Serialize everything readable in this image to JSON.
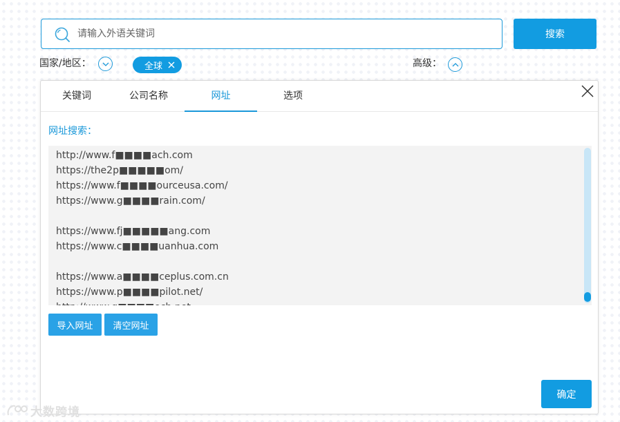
{
  "search": {
    "placeholder": "请输入外语关键词",
    "button_label": "搜索"
  },
  "filters": {
    "region_label": "国家/地区：",
    "region_tag": "全球",
    "advanced_label": "高级："
  },
  "modal": {
    "tabs": [
      {
        "label": "关键词",
        "active": false
      },
      {
        "label": "公司名称",
        "active": false
      },
      {
        "label": "网址",
        "active": true
      },
      {
        "label": "选项",
        "active": false
      }
    ],
    "section_label": "网址搜索：",
    "urls": [
      "http://www.f■■■■ach.com",
      "https://the2p■■■■■om/",
      "https://www.f■■■■ourceusa.com/",
      "https://www.g■■■■rain.com/",
      "",
      "https://www.fj■■■■■ang.com",
      "https://www.c■■■■uanhua.com",
      "",
      "https://www.a■■■■ceplus.com.cn",
      "https://www.p■■■■pilot.net/",
      "http://www.g■■■■ech.net"
    ],
    "import_button": "导入网址",
    "clear_button": "清空网址",
    "confirm_button": "确定"
  },
  "watermark": {
    "text": "大数跨境"
  },
  "colors": {
    "accent": "#129ce1",
    "border": "#1a98d9",
    "textarea_bg": "#f3f3f3",
    "scroll_track": "#c8e6f7"
  }
}
